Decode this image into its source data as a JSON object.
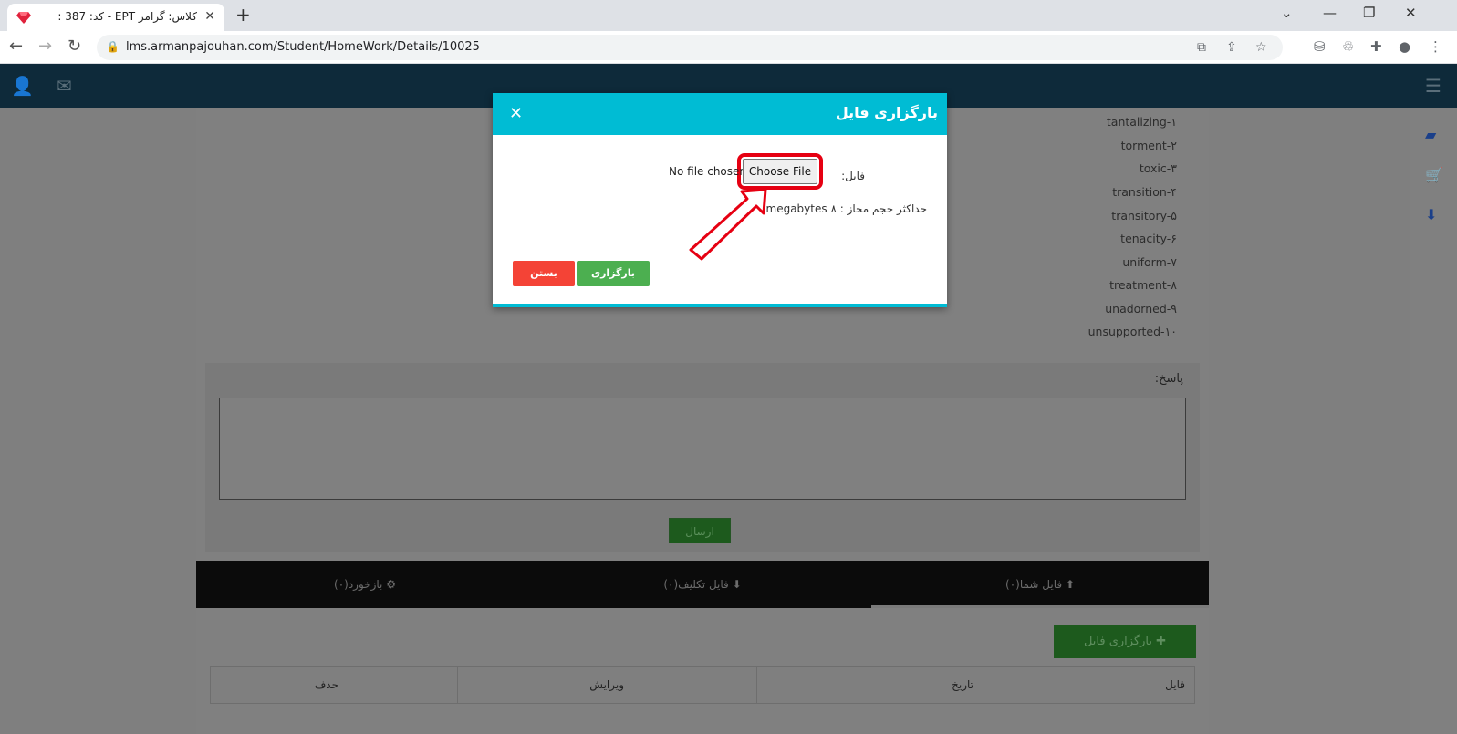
{
  "browser": {
    "tab_title": "کلاس: گرامر EPT - کد: 387 :",
    "url": "lms.armanpajouhan.com/Student/HomeWork/Details/10025",
    "icons": [
      "back-icon",
      "forward-icon",
      "reload-icon",
      "lock-icon",
      "translate-icon",
      "share-icon",
      "star-icon",
      "extension-icon",
      "profile-icon",
      "menu-icon"
    ]
  },
  "words": [
    "tantalizing-۱",
    "torment-۲",
    "toxic-۳",
    "transition-۴",
    "transitory-۵",
    "tenacity-۶",
    "uniform-۷",
    "treatment-۸",
    "unadorned-۹",
    "unsupported-۱۰"
  ],
  "answer": {
    "label": "پاسخ:",
    "send_label": "ارسال"
  },
  "tabs": [
    {
      "label": "فایل شما(۰)",
      "icon": "upload-icon"
    },
    {
      "label": "فایل تکلیف(۰)",
      "icon": "download-icon"
    },
    {
      "label": "بازخورد(۰)",
      "icon": "gear-icon"
    }
  ],
  "upload_button_label": "بارگزاری فایل",
  "table": {
    "headers": [
      "فایل",
      "تاریخ",
      "ویرایش",
      "حذف"
    ]
  },
  "modal": {
    "title": "بارگزاری فایل",
    "file_label": "فایل:",
    "choose_file": "Choose File",
    "no_file": "No file chosen",
    "max_size": "حداکثر حجم مجاز : ۸ megabytes",
    "upload": "بارگزاری",
    "close": "بستن"
  },
  "colors": {
    "modal_header": "#00bcd4",
    "upload_green": "#4caf50",
    "close_red": "#f44336",
    "highlight_red": "#e60012",
    "appbar": "#0e2a3a"
  }
}
